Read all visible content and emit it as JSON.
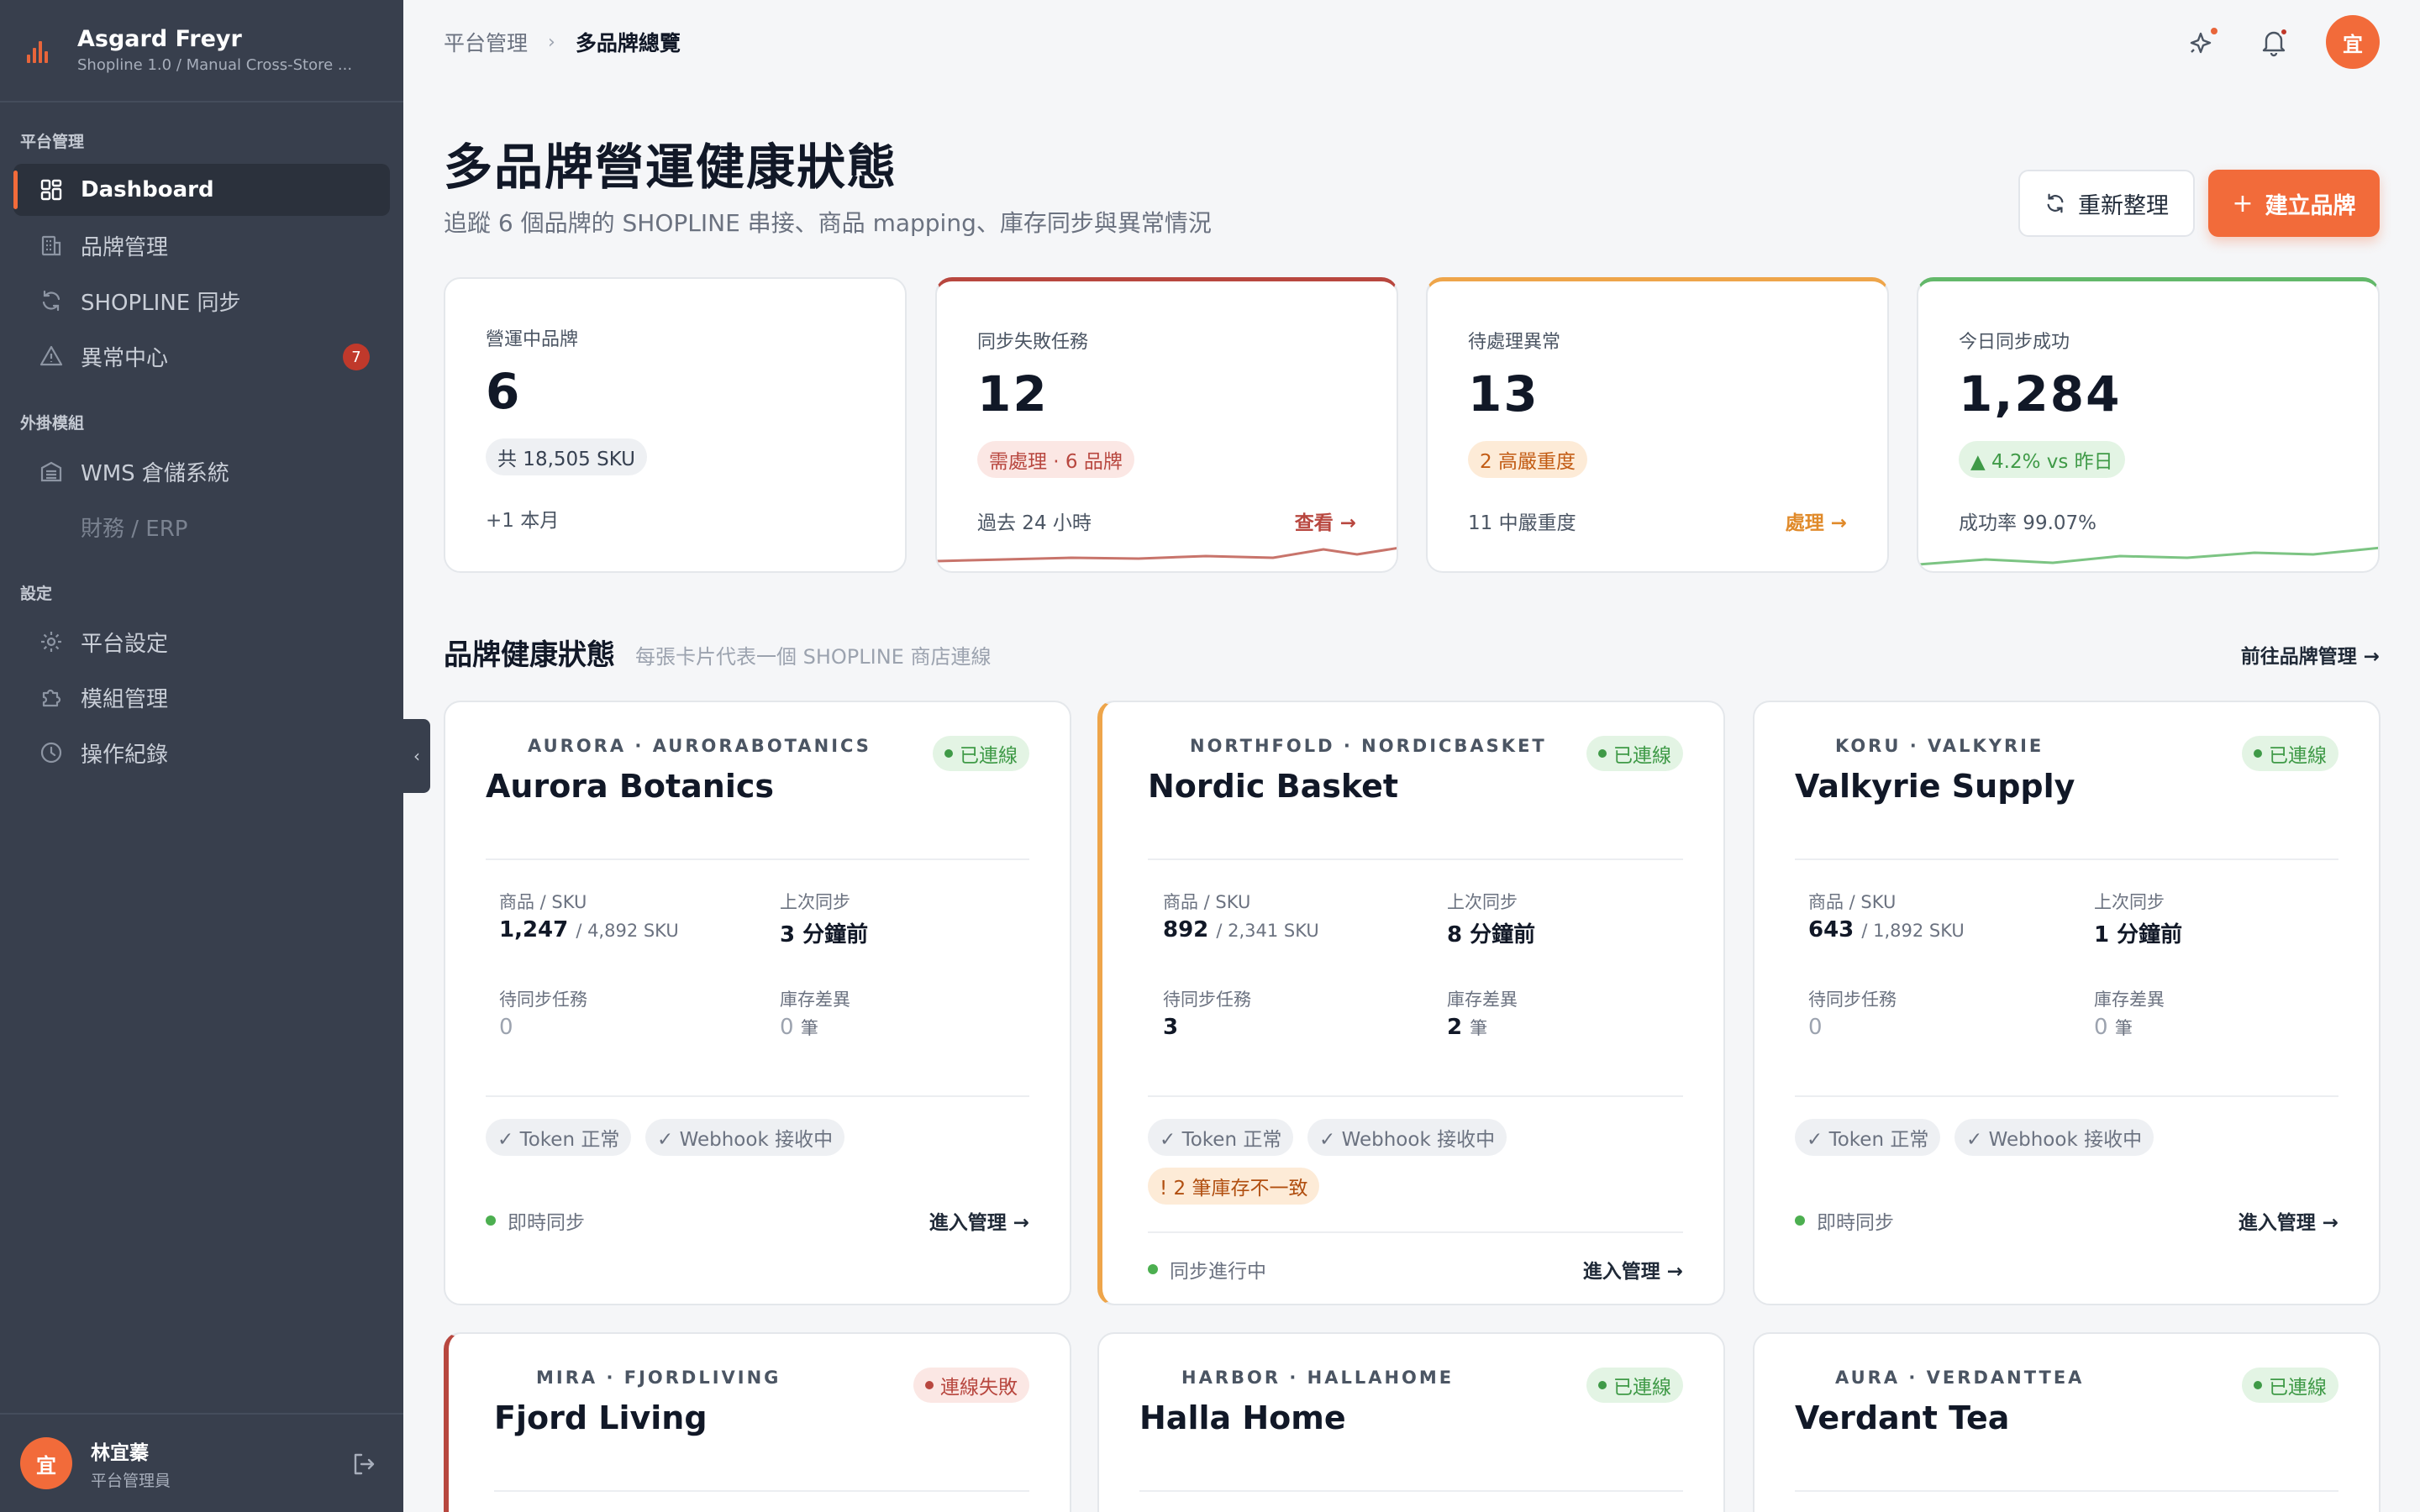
{
  "app": {
    "name": "Asgard Freyr",
    "subtitle": "Shopline 1.0 / Manual Cross-Store ..."
  },
  "sidebar": {
    "sections": [
      {
        "title": "平台管理",
        "items": [
          {
            "label": "Dashboard",
            "icon": "dashboard-icon",
            "active": true
          },
          {
            "label": "品牌管理",
            "icon": "building-icon"
          },
          {
            "label": "SHOPLINE 同步",
            "icon": "sync-icon"
          },
          {
            "label": "異常中心",
            "icon": "warning-icon",
            "badge": "7"
          }
        ]
      },
      {
        "title": "外掛模組",
        "items": [
          {
            "label": "WMS 倉儲系統",
            "icon": "warehouse-icon"
          },
          {
            "label": "財務 / ERP",
            "icon": "",
            "disabled": true
          }
        ]
      },
      {
        "title": "設定",
        "items": [
          {
            "label": "平台設定",
            "icon": "gear-icon"
          },
          {
            "label": "模組管理",
            "icon": "puzzle-icon"
          },
          {
            "label": "操作紀錄",
            "icon": "clock-icon"
          }
        ]
      }
    ],
    "user": {
      "initial": "宜",
      "name": "林宜蓁",
      "role": "平台管理員"
    }
  },
  "breadcrumb": {
    "parent": "平台管理",
    "separator": "›",
    "current": "多品牌總覽"
  },
  "topbar": {
    "avatar_initial": "宜"
  },
  "header": {
    "title": "多品牌營運健康狀態",
    "subtitle": "追蹤 6 個品牌的 SHOPLINE 串接、商品 mapping、庫存同步與異常情況",
    "refresh_label": "重新整理",
    "create_label": "建立品牌"
  },
  "stats": [
    {
      "label": "營運中品牌",
      "value": "6",
      "pill": "共 18,505 SKU",
      "foot": "+1 本月",
      "link": ""
    },
    {
      "label": "同步失敗任務",
      "value": "12",
      "pill": "需處理 · 6 品牌",
      "foot": "過去 24 小時",
      "link": "查看 →"
    },
    {
      "label": "待處理異常",
      "value": "13",
      "pill": "2 高嚴重度",
      "foot": "11 中嚴重度",
      "link": "處理 →"
    },
    {
      "label": "今日同步成功",
      "value": "1,284",
      "pill": "▲ 4.2% vs 昨日",
      "foot": "成功率 99.07%",
      "link": ""
    }
  ],
  "section": {
    "title": "品牌健康狀態",
    "subtitle": "每張卡片代表一個 SHOPLINE 商店連線",
    "link": "前往品牌管理 →"
  },
  "brand_labels": {
    "products": "商品 / SKU",
    "last_sync": "上次同步",
    "pending": "待同步任務",
    "diff": "庫存差異",
    "enter": "進入管理 →"
  },
  "brands": [
    {
      "meta": "AURORA · AURORABOTANICS",
      "name": "Aurora Botanics",
      "status": "已連線",
      "products": "1,247",
      "skus": "/ 4,892 SKU",
      "last_sync": "3 分鐘前",
      "pending": "0",
      "diff": "0",
      "diff_unit": "筆",
      "chips": [
        "✓ Token 正常",
        "✓ Webhook 接收中"
      ],
      "alert": "",
      "sync": "即時同步"
    },
    {
      "meta": "NORTHFOLD · NORDICBASKET",
      "name": "Nordic Basket",
      "status": "已連線",
      "products": "892",
      "skus": "/ 2,341 SKU",
      "last_sync": "8 分鐘前",
      "pending": "3",
      "diff": "2",
      "diff_unit": "筆",
      "chips": [
        "✓ Token 正常",
        "✓ Webhook 接收中"
      ],
      "alert": "! 2 筆庫存不一致",
      "sync": "同步進行中"
    },
    {
      "meta": "KORU · VALKYRIE",
      "name": "Valkyrie Supply",
      "status": "已連線",
      "products": "643",
      "skus": "/ 1,892 SKU",
      "last_sync": "1 分鐘前",
      "pending": "0",
      "diff": "0",
      "diff_unit": "筆",
      "chips": [
        "✓ Token 正常",
        "✓ Webhook 接收中"
      ],
      "alert": "",
      "sync": "即時同步"
    },
    {
      "meta": "MIRA · FJORDLIVING",
      "name": "Fjord Living",
      "status": "連線失敗"
    },
    {
      "meta": "HARBOR · HALLAHOME",
      "name": "Halla Home",
      "status": "已連線"
    },
    {
      "meta": "AURA · VERDANTTEA",
      "name": "Verdant Tea",
      "status": "已連線"
    }
  ],
  "colors": {
    "accent": "#f26b3a",
    "sidebar": "#383f4d",
    "error": "#b8473f",
    "warning": "#eea54a",
    "success": "#63b86a"
  }
}
